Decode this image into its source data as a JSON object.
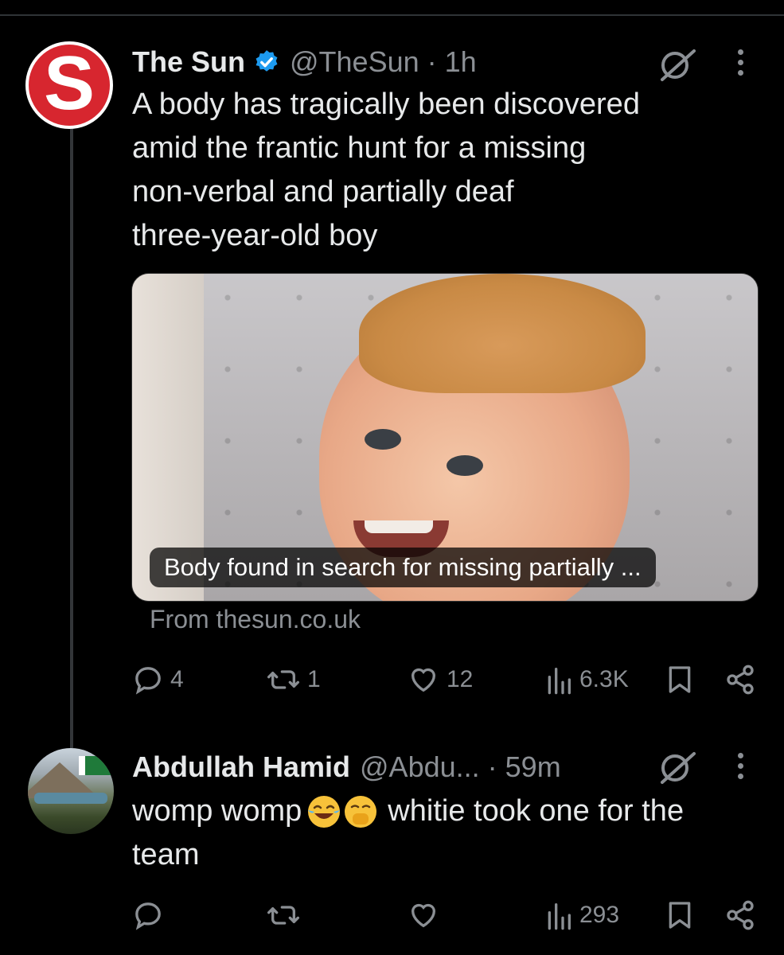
{
  "tweets": [
    {
      "author_name": "The Sun",
      "handle": "@TheSun",
      "time": "· 1h",
      "text_lines": [
        "A body has tragically been discovered",
        "amid the frantic hunt for a missing",
        "non-verbal and partially deaf",
        "three-year-old boy"
      ],
      "avatar_letter": "S",
      "card": {
        "caption": "Body found in search for missing partially ...",
        "source": "From thesun.co.uk"
      },
      "stats": {
        "replies": "4",
        "reposts": "1",
        "likes": "12",
        "views": "6.3K"
      }
    },
    {
      "author_name": "Abdullah Hamid",
      "handle": "@Abdu...",
      "time": "· 59m",
      "text_line1": "womp womp",
      "emojis": [
        "face-with-tears-of-joy",
        "face-with-hand-over-mouth"
      ],
      "text_line1_after": "whitie took one for the",
      "text_line2": "team",
      "stats": {
        "replies": "",
        "reposts": "",
        "likes": "",
        "views": "293"
      }
    }
  ],
  "colors": {
    "background": "#000000",
    "text": "#e7e9ea",
    "muted": "#8b8f94",
    "verified": "#1d9bf0",
    "sun_red": "#d7262f"
  }
}
